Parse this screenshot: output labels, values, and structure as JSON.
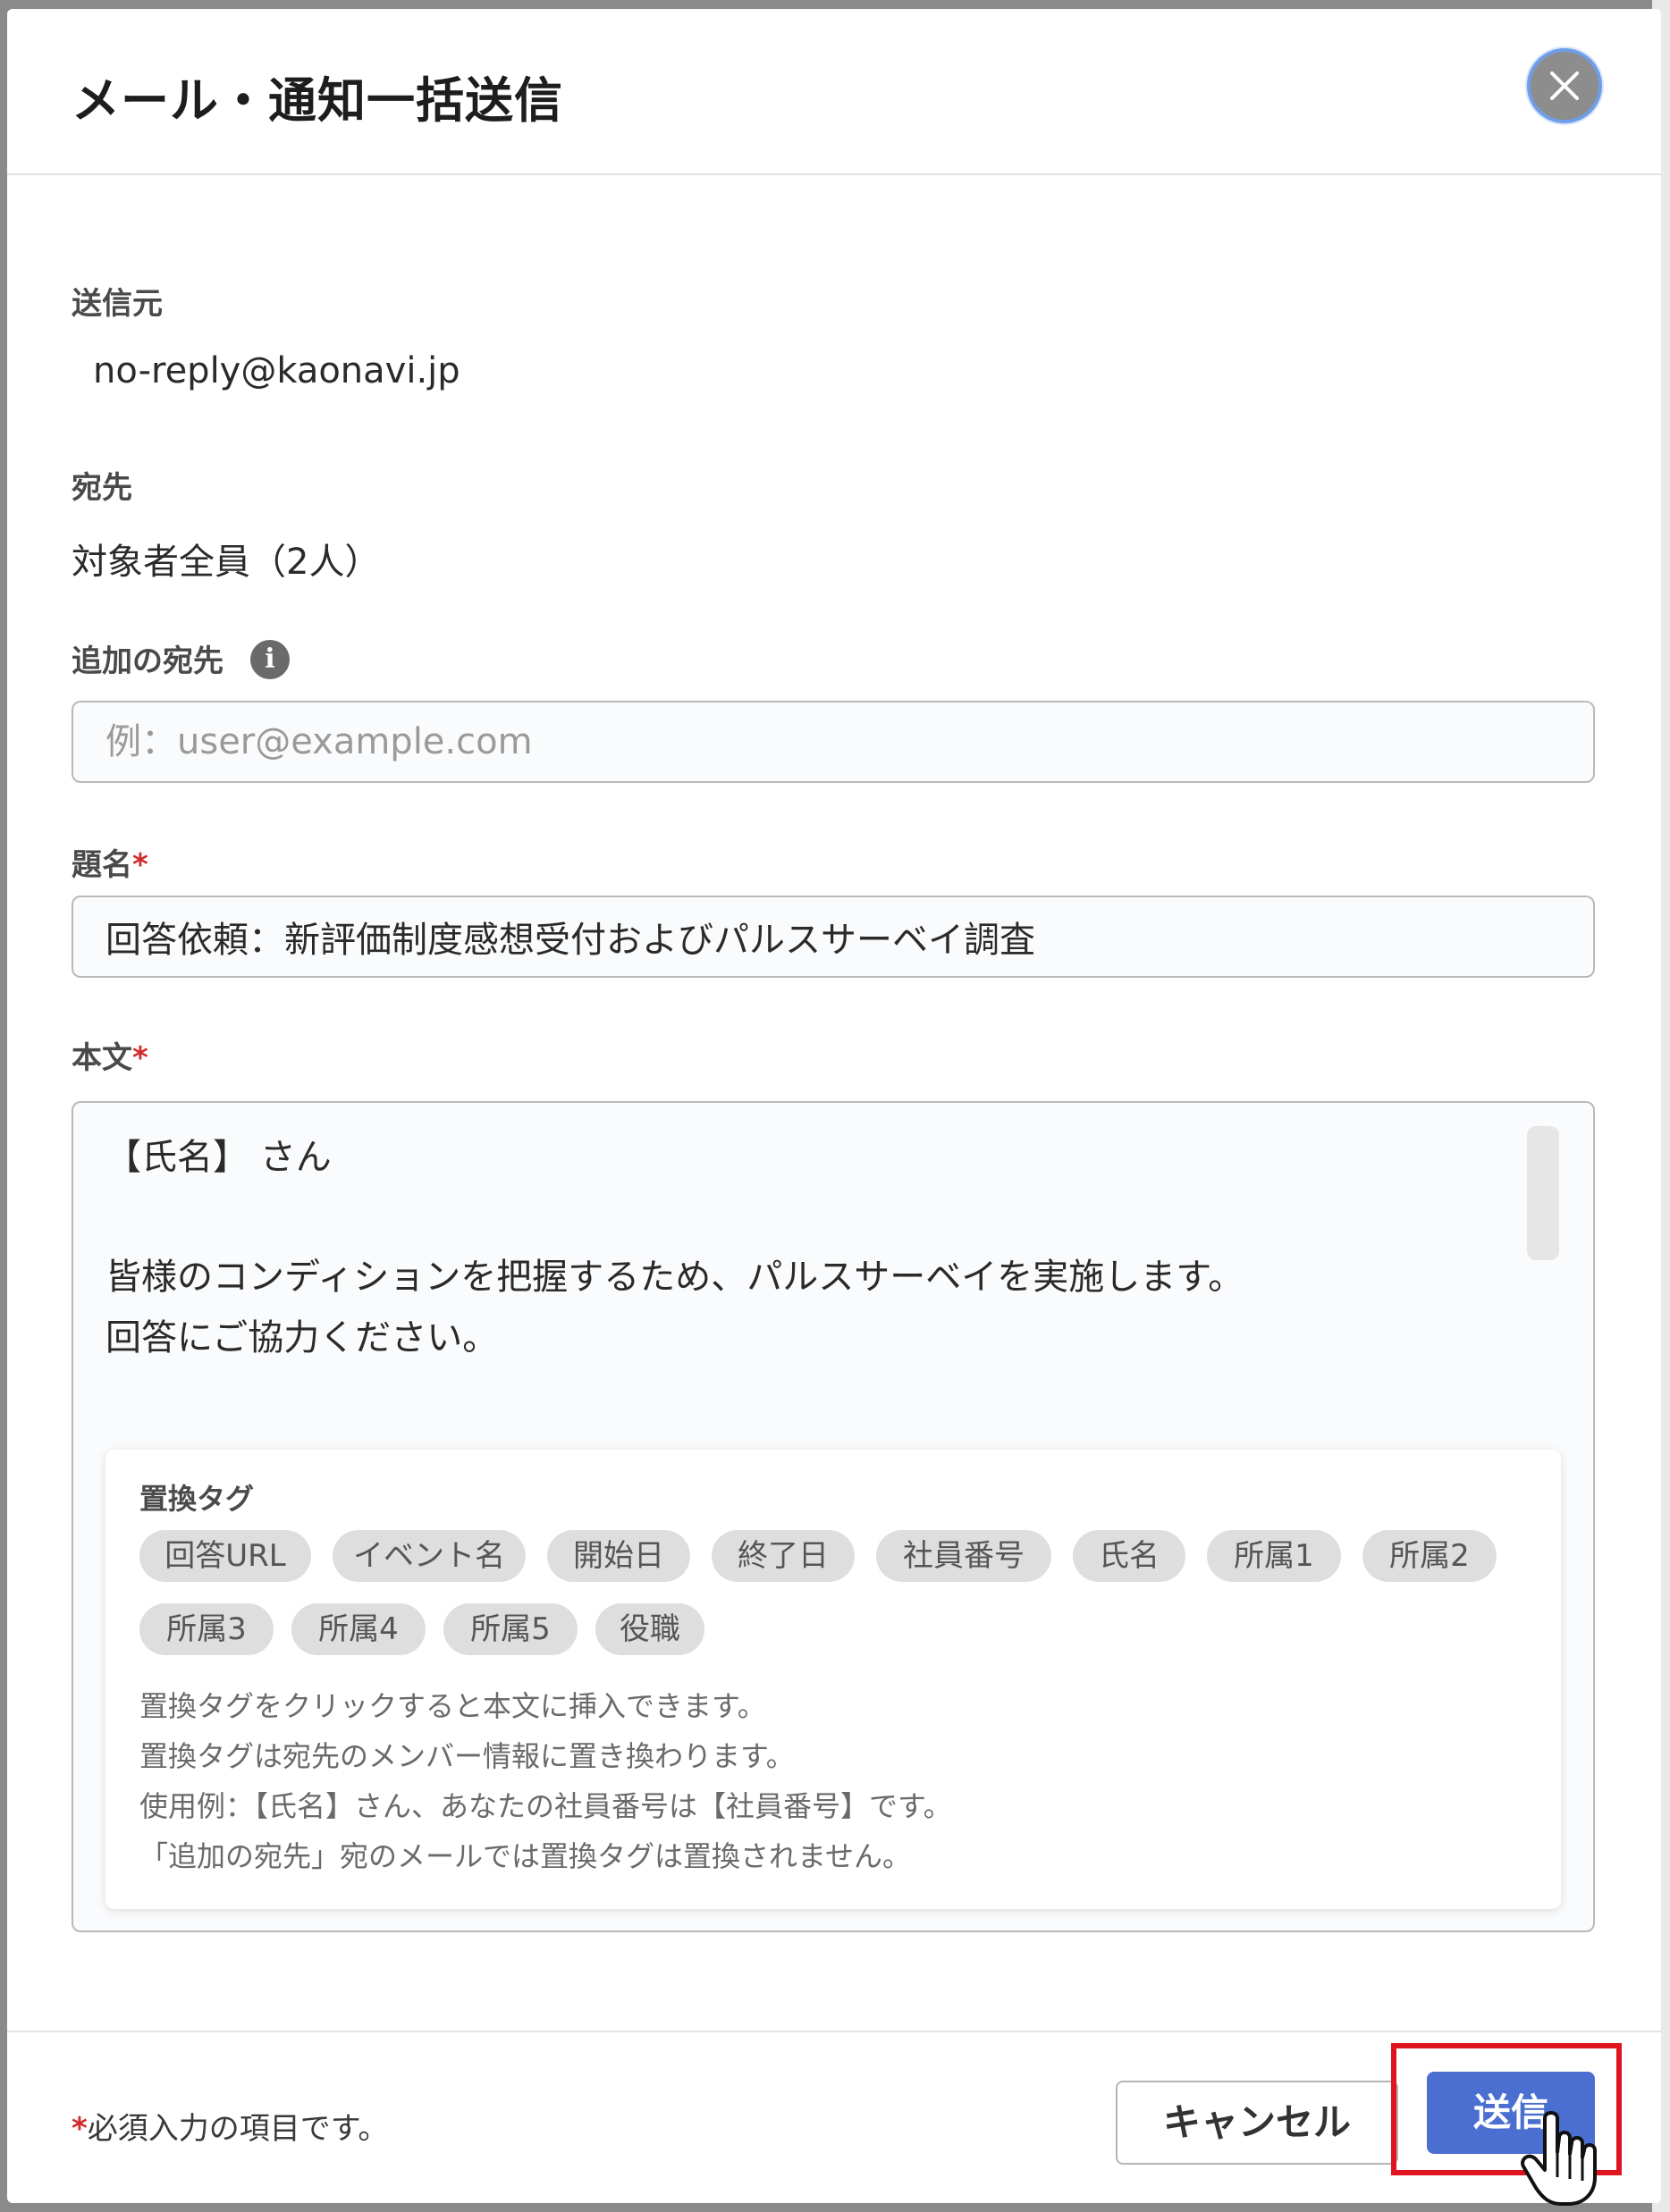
{
  "dialog": {
    "title": "メール・通知一括送信",
    "close_icon": "close-icon"
  },
  "sender": {
    "label": "送信元",
    "value": "no-reply@kaonavi.jp"
  },
  "recipient": {
    "label": "宛先",
    "value": "対象者全員（2人）"
  },
  "additional_recipients": {
    "label": "追加の宛先",
    "info_icon": "info-icon",
    "placeholder": "例：user@example.com",
    "value": ""
  },
  "subject": {
    "label": "題名",
    "required_mark": "*",
    "value": "回答依頼：新評価制度感想受付およびパルスサーベイ調査"
  },
  "body": {
    "label": "本文",
    "required_mark": "*",
    "lines": [
      "【氏名】 さん",
      "皆様のコンディションを把握するため、パルスサーベイを実施します。",
      "回答にご協力ください。"
    ]
  },
  "replacement_tags": {
    "title": "置換タグ",
    "tags": [
      "回答URL",
      "イベント名",
      "開始日",
      "終了日",
      "社員番号",
      "氏名",
      "所属1",
      "所属2",
      "所属3",
      "所属4",
      "所属5",
      "役職"
    ],
    "help": [
      "置換タグをクリックすると本文に挿入できます。",
      "置換タグは宛先のメンバー情報に置き換わります。",
      "使用例：【氏名】さん、あなたの社員番号は【社員番号】です。",
      "「追加の宛先」宛のメールでは置換タグは置換されません。"
    ]
  },
  "footer": {
    "required_mark": "*",
    "note": "必須入力の項目です。",
    "cancel_label": "キャンセル",
    "send_label": "送信"
  },
  "colors": {
    "primary_button": "#4a6fd0",
    "required_mark": "#d12b2b",
    "highlight_box": "#e0141f",
    "close_button_ring": "#6f9de8"
  }
}
